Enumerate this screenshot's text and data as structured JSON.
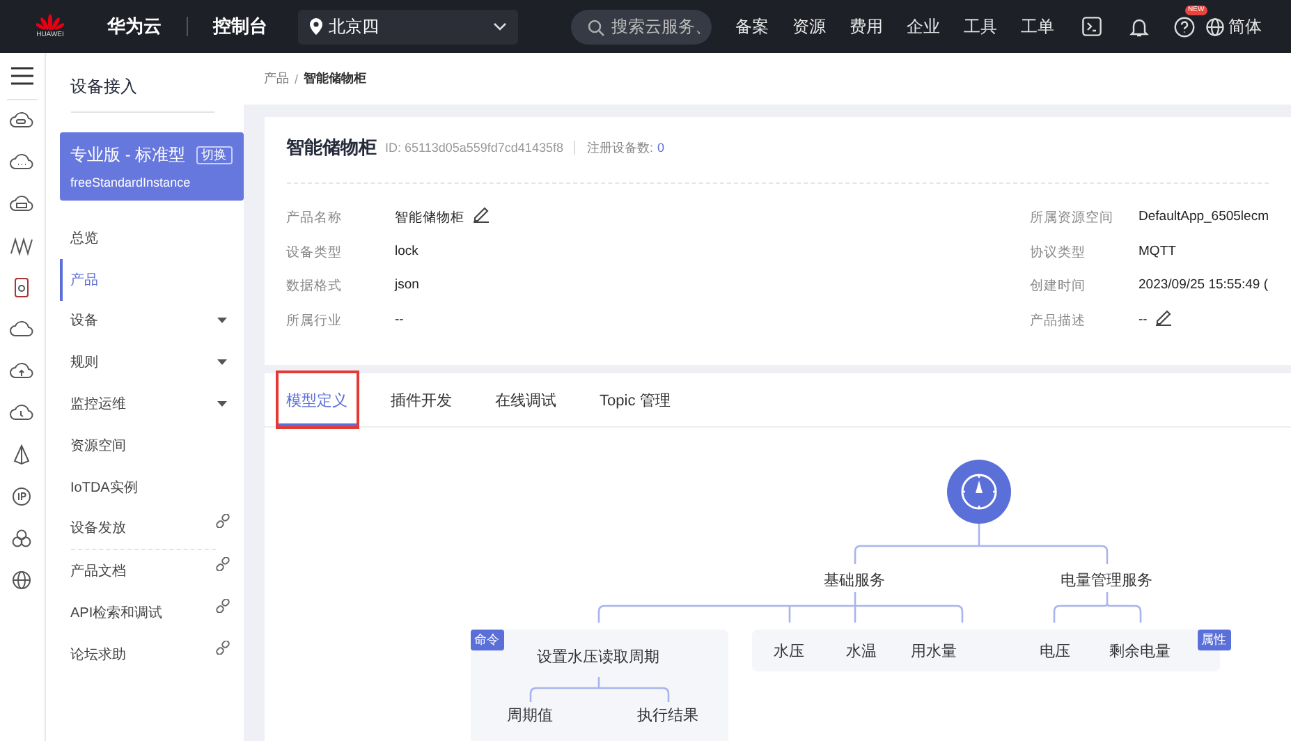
{
  "topbar": {
    "logo_text": "HUAWEI",
    "brand": "华为云",
    "console": "控制台",
    "region": "北京四",
    "search": {
      "placeholder": "搜索云服务、"
    },
    "links": [
      "备案",
      "资源",
      "费用",
      "企业",
      "工具",
      "工单"
    ],
    "help_badge": "NEW",
    "language": "简体"
  },
  "nav": {
    "title": "设备接入",
    "instance": {
      "edition": "专业版 - 标准型",
      "switch": "切换",
      "name": "freeStandardInstance"
    },
    "items": [
      {
        "label": "总览",
        "selected": false,
        "expandable": false,
        "external": false
      },
      {
        "label": "产品",
        "selected": true,
        "expandable": false,
        "external": false
      },
      {
        "label": "设备",
        "selected": false,
        "expandable": true,
        "external": false
      },
      {
        "label": "规则",
        "selected": false,
        "expandable": true,
        "external": false
      },
      {
        "label": "监控运维",
        "selected": false,
        "expandable": true,
        "external": false
      },
      {
        "label": "资源空间",
        "selected": false,
        "expandable": false,
        "external": false
      },
      {
        "label": "IoTDA实例",
        "selected": false,
        "expandable": false,
        "external": false
      },
      {
        "label": "设备发放",
        "selected": false,
        "expandable": false,
        "external": true
      },
      {
        "label": "产品文档",
        "selected": false,
        "expandable": false,
        "external": true
      },
      {
        "label": "API检索和调试",
        "selected": false,
        "expandable": false,
        "external": true
      },
      {
        "label": "论坛求助",
        "selected": false,
        "expandable": false,
        "external": true
      }
    ]
  },
  "breadcrumb": {
    "items": [
      "产品",
      "智能储物柜"
    ],
    "separator": "/"
  },
  "product": {
    "name": "智能储物柜",
    "id": "ID: 65113d05a559fd7cd41435f8",
    "device_count_label": "注册设备数:",
    "device_count": "0",
    "fields_left": [
      {
        "label": "产品名称",
        "value": "智能储物柜",
        "editable": true
      },
      {
        "label": "设备类型",
        "value": "lock",
        "editable": false
      },
      {
        "label": "数据格式",
        "value": "json",
        "editable": false
      },
      {
        "label": "所属行业",
        "value": "--",
        "editable": false
      }
    ],
    "fields_right": [
      {
        "label": "所属资源空间",
        "value": "DefaultApp_6505lecm",
        "editable": false
      },
      {
        "label": "协议类型",
        "value": "MQTT",
        "editable": false
      },
      {
        "label": "创建时间",
        "value": "2023/09/25 15:55:49 (",
        "editable": false
      },
      {
        "label": "产品描述",
        "value": "--",
        "editable": true
      }
    ]
  },
  "tabs": [
    {
      "label": "模型定义",
      "selected": true,
      "highlighted": true
    },
    {
      "label": "插件开发",
      "selected": false,
      "highlighted": false
    },
    {
      "label": "在线调试",
      "selected": false,
      "highlighted": false
    },
    {
      "label": "Topic 管理",
      "selected": false,
      "highlighted": false
    }
  ],
  "model": {
    "services": [
      {
        "name": "基础服务",
        "properties": [
          "水压",
          "水温",
          "用水量"
        ]
      },
      {
        "name": "电量管理服务",
        "properties": [
          "电压",
          "剩余电量"
        ]
      }
    ],
    "command": {
      "tag": "命令",
      "name": "设置水压读取周期",
      "params": [
        "周期值",
        "执行结果"
      ]
    },
    "property_tag": "属性"
  }
}
